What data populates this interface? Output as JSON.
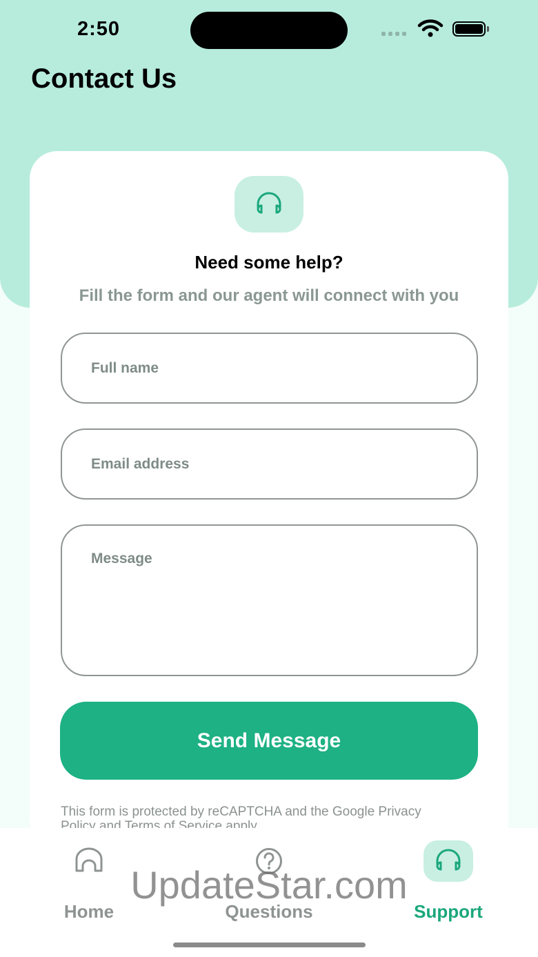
{
  "status_bar": {
    "time": "2:50"
  },
  "header": {
    "title": "Contact Us"
  },
  "card": {
    "icon": "headset-icon",
    "title": "Need some help?",
    "subtitle": "Fill the form and our agent will connect with you",
    "fields": {
      "full_name": {
        "placeholder": "Full name",
        "value": ""
      },
      "email": {
        "placeholder": "Email address",
        "value": ""
      },
      "message": {
        "placeholder": "Message",
        "value": ""
      }
    },
    "send_label": "Send Message",
    "recaptcha_text": "This form is protected by reCAPTCHA and the Google Privacy Policy and Terms of Service apply."
  },
  "tabs": [
    {
      "label": "Home",
      "icon": "home-icon",
      "active": false
    },
    {
      "label": "Questions",
      "icon": "question-icon",
      "active": false
    },
    {
      "label": "Support",
      "icon": "headset-icon",
      "active": true
    }
  ],
  "watermark": "UpdateStar.com",
  "colors": {
    "header_bg": "#b7ecdc",
    "accent": "#1db184",
    "active_tab": "#1aa77c",
    "icon_bg": "#c8efe2"
  }
}
